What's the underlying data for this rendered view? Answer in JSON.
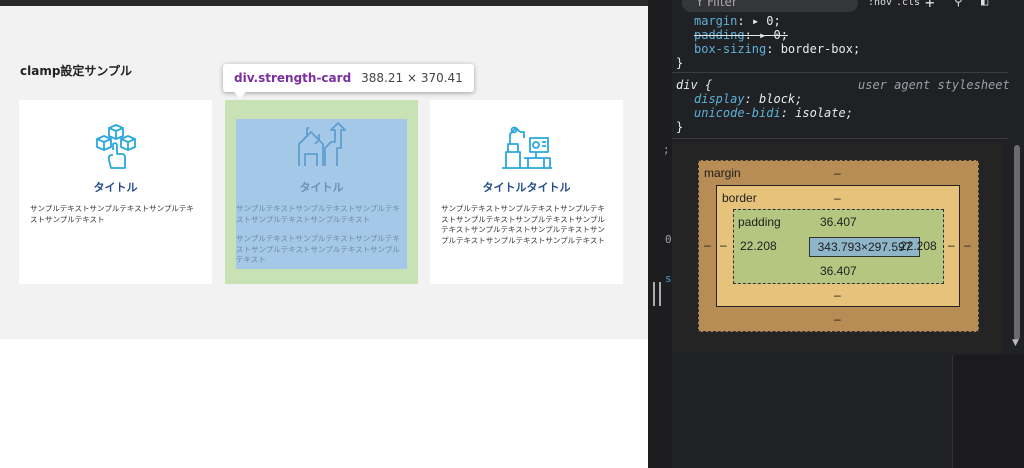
{
  "page": {
    "section_title": "clamp設定サンプル",
    "cards": [
      {
        "icon": "building-blocks-icon",
        "title": "タイトル",
        "texts": [
          "サンプルテキストサンプルテキストサンプルテキストサンプルテキスト"
        ]
      },
      {
        "icon": "growth-chart-icon",
        "title": "タイトル",
        "texts": [
          "サンプルテキストサンプルテキストサンプルテキストサンプルテキストサンプルテキスト",
          "サンプルテキストサンプルテキストサンプルテキストサンプルテキストサンプルテキストサンプルテキスト"
        ]
      },
      {
        "icon": "factory-workstation-icon",
        "title": "タイトルタイトル",
        "texts": [
          "サンプルテキストサンプルテキストサンプルテキストサンプルテキストサンプルテキストサンプルテキストサンプルテキストサンプルテキストサンプルテキストサンプルテキストサンプルテキスト"
        ]
      }
    ],
    "tooltip": {
      "selector": "div.strength-card",
      "size": "388.21 × 370.41"
    }
  },
  "devtools": {
    "toolbar": {
      "filter_placeholder": "Filter",
      "hov": ":hov",
      "cls": ".cls",
      "add": "+"
    },
    "gutter": {
      "m1": ";",
      "m2": "0",
      "m3": "s"
    },
    "styles": {
      "rule1": [
        {
          "prop": "margin",
          "val": "▸ 0;",
          "strike": false
        },
        {
          "prop": "padding",
          "val": "▸ 0;",
          "strike": true
        },
        {
          "prop": "box-sizing",
          "val": "border-box;",
          "strike": false
        }
      ],
      "rule1_close": "}",
      "rule2_selector": "div {",
      "rule2_source": "user agent stylesheet",
      "rule2": [
        {
          "prop": "display",
          "val": "block;"
        },
        {
          "prop": "unicode-bidi",
          "val": "isolate;"
        }
      ],
      "rule2_close": "}"
    },
    "box_model": {
      "margin_label": "margin",
      "margin_top": "–",
      "margin_bottom": "–",
      "margin_left": "–",
      "margin_right": "–",
      "border_label": "border",
      "border_top": "–",
      "border_bottom": "–",
      "border_left": "–",
      "border_right": "–",
      "padding_label": "padding",
      "padding_top": "36.407",
      "padding_bottom": "36.407",
      "padding_left": "22.208",
      "padding_right": "22.208",
      "content": "343.793×297.597"
    }
  },
  "colors": {
    "highlight_padding": "#c9e2b5",
    "highlight_content": "#a4c8e8",
    "card_title": "#244c8a",
    "icon_stroke": "#2aa8dc"
  }
}
